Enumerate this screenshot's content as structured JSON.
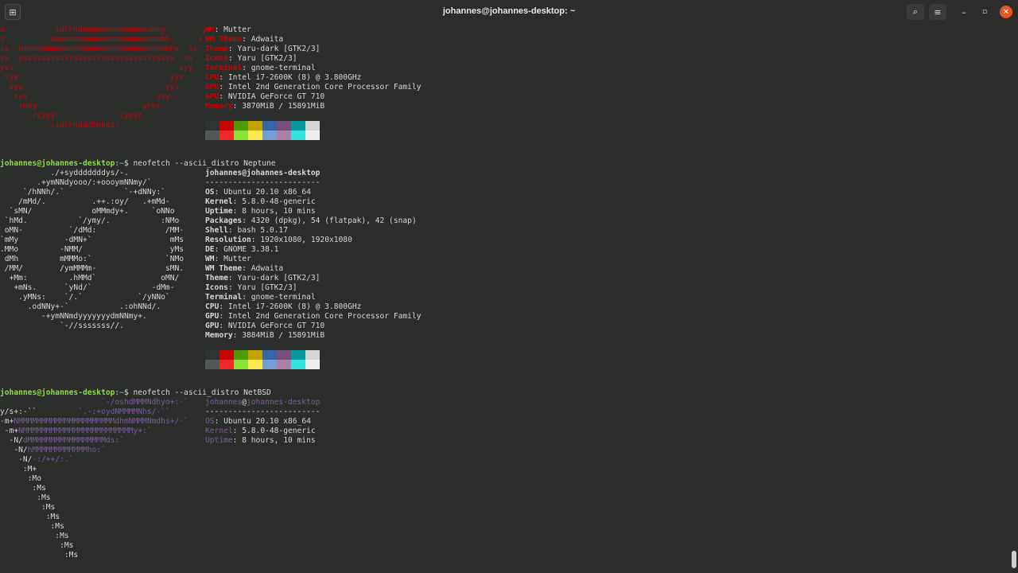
{
  "window": {
    "title": "johannes@johannes-desktop: ~",
    "buttons": {
      "new_tab": "⊞",
      "search": "⌕",
      "menu": "≡",
      "minimize": "–",
      "maximize": "▫",
      "close": "✕"
    }
  },
  "ubuntu_block": {
    "ascii": [
      "o           sdhhhdmmmmmmmmmmmmmmdmmy        y",
      "s         .dmmmmmmmmmmmmmmmmmmmmmmmmh.     s",
      "ss  hmmmmmmmmmmmmmmmmmmmmmmmmmmmmmmmmhs  ss",
      "ss  ysssssssssssssssssssssssssssssssss  ss",
      "yss                                    syy",
      " syy                                 yys",
      "  syy                               yys",
      "   sys                            ysy",
      "    +hhy                       yhh+",
      "       /syyy              syyy/",
      "          .:sdhhhdddhhhds:."
    ],
    "info": [
      {
        "key": "WM",
        "value": "Mutter"
      },
      {
        "key": "WM Theme",
        "value": "Adwaita"
      },
      {
        "key": "Theme",
        "value": "Yaru-dark [GTK2/3]"
      },
      {
        "key": "Icons",
        "value": "Yaru [GTK2/3]"
      },
      {
        "key": "Terminal",
        "value": "gnome-terminal"
      },
      {
        "key": "CPU",
        "value": "Intel i7-2600K (8) @ 3.800GHz"
      },
      {
        "key": "GPU",
        "value": "Intel 2nd Generation Core Processor Family"
      },
      {
        "key": "GPU",
        "value": "NVIDIA GeForce GT 710"
      },
      {
        "key": "Memory",
        "value": "3870MiB / 15891MiB"
      }
    ]
  },
  "neptune_block": {
    "prompt_user": "johannes@johannes-desktop",
    "prompt_path": ":~",
    "prompt_symbol": "$",
    "command": " neofetch --ascii_distro Neptune",
    "ascii": [
      "           ./+sydddddddys/-.",
      "        .+ymNNdyooo/:+oooymNNmy/`",
      "     `/hNNh/.`             `-+dNNy:`",
      "    /mMd/.          .++.:oy/   .+mMd-",
      "  `sMN/             oMMmdy+.     `oNNo",
      " `hMd.           `/ymy/.           :NMo",
      " oMN-          `/dMd:               /MM-",
      "`mMy          -dMN+`                 mMs",
      ".MMo         -NMM/                   yMs",
      " dMh         mMMMo:`                `NMo",
      " /MM/        /ymMMMm-               sMN.",
      "  +Mm:         .hMMd`              oMN/",
      "   +mNs.      `yNd/`             -dMm-",
      "    .yMNs:    `/.`            `/yNNo`",
      "      .odNNy+-`           .:ohNNd/.",
      "         -+ymNNmdyyyyyyydmNNmy+.",
      "             `-//sssssss//."
    ],
    "host": "johannes@johannes-desktop",
    "separator": "-------------------------",
    "info": [
      {
        "key": "OS",
        "value": "Ubuntu 20.10 x86_64"
      },
      {
        "key": "Kernel",
        "value": "5.8.0-48-generic"
      },
      {
        "key": "Uptime",
        "value": "8 hours, 10 mins"
      },
      {
        "key": "Packages",
        "value": "4320 (dpkg), 54 (flatpak), 42 (snap)"
      },
      {
        "key": "Shell",
        "value": "bash 5.0.17"
      },
      {
        "key": "Resolution",
        "value": "1920x1080, 1920x1080"
      },
      {
        "key": "DE",
        "value": "GNOME 3.38.1"
      },
      {
        "key": "WM",
        "value": "Mutter"
      },
      {
        "key": "WM Theme",
        "value": "Adwaita"
      },
      {
        "key": "Theme",
        "value": "Yaru-dark [GTK2/3]"
      },
      {
        "key": "Icons",
        "value": "Yaru [GTK2/3]"
      },
      {
        "key": "Terminal",
        "value": "gnome-terminal"
      },
      {
        "key": "CPU",
        "value": "Intel i7-2600K (8) @ 3.800GHz"
      },
      {
        "key": "GPU",
        "value": "Intel 2nd Generation Core Processor Family"
      },
      {
        "key": "GPU",
        "value": "NVIDIA GeForce GT 710"
      },
      {
        "key": "Memory",
        "value": "3884MiB / 15891MiB"
      }
    ]
  },
  "netbsd_block": {
    "prompt_user": "johannes@johannes-desktop",
    "prompt_path": ":~",
    "prompt_symbol": "$",
    "command": " neofetch --ascii_distro NetBSD",
    "ascii_lead": [
      "",
      "y/s+:-``",
      "-m+",
      " -m+",
      "  -N/",
      "   -N/",
      "    -N/",
      "     :M+",
      "      :Mo",
      "       :Ms",
      "        :Ms",
      "         :Ms",
      "          :Ms",
      "           :Ms",
      "            :Ms",
      "             :Ms",
      "              :Ms"
    ],
    "ascii_tail": [
      "                      `-/oshdMMMNdhyo+:-`",
      "         `.-:+oydNMMMMNhs/-``",
      "NMMMMMMMMMMMMMMMMMMMMMdhmNMMMNmdhs+/-`",
      "NMMMMMMMMMMMMMMMMMMMMMMMMy+:`",
      "dMMMMMMMMMMMMMMMMMds:`",
      "hMMMMMMMMMMMMho:`",
      "-:/++/:.`",
      "",
      "",
      "",
      "",
      "",
      "",
      "",
      "",
      "",
      ""
    ],
    "host_user": "johannes",
    "host_at": "@",
    "host_machine": "johannes-desktop",
    "separator": "-------------------------",
    "info": [
      {
        "key": "OS",
        "value": "Ubuntu 20.10 x86_64"
      },
      {
        "key": "Kernel",
        "value": "5.8.0-48-generic"
      },
      {
        "key": "Uptime",
        "value": "8 hours, 10 mins"
      }
    ]
  },
  "palette": {
    "top": [
      "#2e3436",
      "#cc0000",
      "#4e9a06",
      "#c4a000",
      "#3465a4",
      "#75507b",
      "#06989a",
      "#d3d7cf"
    ],
    "bottom": [
      "#555753",
      "#ef2929",
      "#8ae234",
      "#fce94f",
      "#729fcf",
      "#ad7fa8",
      "#34e2e2",
      "#eeeeec"
    ]
  }
}
